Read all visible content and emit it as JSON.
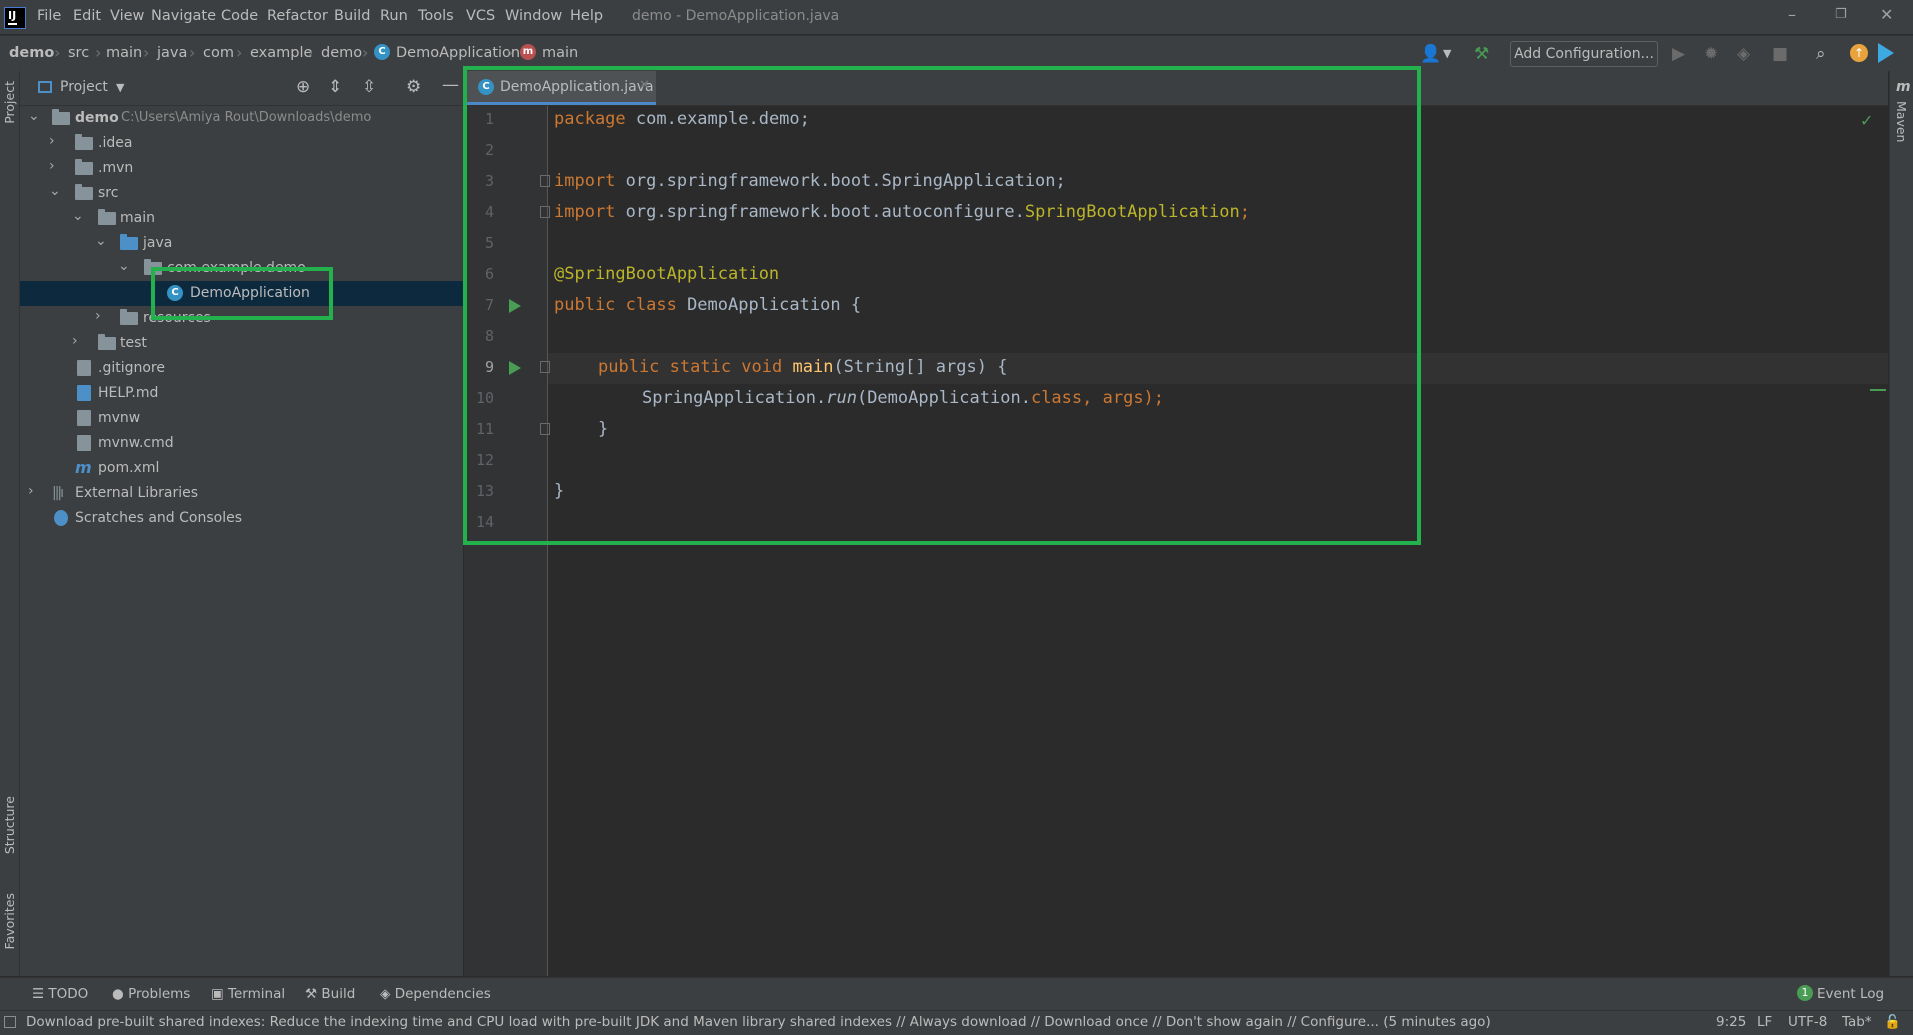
{
  "app": {
    "window_title": "demo - DemoApplication.java",
    "logo_text": "IJ"
  },
  "menu": [
    "File",
    "Edit",
    "View",
    "Navigate",
    "Code",
    "Refactor",
    "Build",
    "Run",
    "Tools",
    "VCS",
    "Window",
    "Help"
  ],
  "window_controls": [
    "–",
    "❐",
    "✕"
  ],
  "breadcrumb": [
    "demo",
    "src",
    "main",
    "java",
    "com",
    "example",
    "demo",
    "DemoApplication",
    "main"
  ],
  "breadcrumb_icons": {
    "class": "C",
    "method": "m"
  },
  "toolbar": {
    "add_configuration": "Add Configuration..."
  },
  "left_strip": {
    "project": "Project",
    "structure": "Structure",
    "favorites": "Favorites"
  },
  "right_strip": {
    "maven": "Maven",
    "maven_icon_text": "m"
  },
  "project_panel": {
    "title": "Project",
    "tree": [
      {
        "label": "demo",
        "path": "C:\\Users\\Amiya Rout\\Downloads\\demo"
      },
      {
        "label": ".idea"
      },
      {
        "label": ".mvn"
      },
      {
        "label": "src"
      },
      {
        "label": "main"
      },
      {
        "label": "java"
      },
      {
        "label": "com.example.demo"
      },
      {
        "label": "DemoApplication"
      },
      {
        "label": "resources"
      },
      {
        "label": "test"
      },
      {
        "label": ".gitignore"
      },
      {
        "label": "HELP.md"
      },
      {
        "label": "mvnw"
      },
      {
        "label": "mvnw.cmd"
      },
      {
        "label": "pom.xml"
      },
      {
        "label": "External Libraries"
      },
      {
        "label": "Scratches and Consoles"
      }
    ]
  },
  "editor": {
    "tab_label": "DemoApplication.java",
    "line_numbers": [
      "1",
      "2",
      "3",
      "4",
      "5",
      "6",
      "7",
      "8",
      "9",
      "10",
      "11",
      "12",
      "13",
      "14"
    ],
    "code": {
      "l1_kw": "package",
      "l1_rest": " com.example.demo;",
      "l3_kw": "import",
      "l3_rest": " org.springframework.boot.SpringApplication;",
      "l4_kw": "import",
      "l4_mid": " org.springframework.boot.autoconfigure.",
      "l4_ann": "SpringBootApplication",
      "l4_end": ";",
      "l6_ann": "@SpringBootApplication",
      "l7_kw": "public class",
      "l7_rest": " DemoApplication {",
      "l9_kw": "public static void",
      "l9_fn": "main",
      "l9_rest": "(String[] args) {",
      "l10_a": "SpringApplication.",
      "l10_run": "run",
      "l10_b": "(DemoApplication.",
      "l10_cls": "class",
      "l10_c": ", args);",
      "l11": "}",
      "l13": "}"
    }
  },
  "tool_windows": [
    "TODO",
    "Problems",
    "Terminal",
    "Build",
    "Dependencies"
  ],
  "event_log": {
    "label": "Event Log",
    "count": "1"
  },
  "status": {
    "message": "Download pre-built shared indexes: Reduce the indexing time and CPU load with pre-built JDK and Maven library shared indexes // Always download // Download once // Don't show again // Configure... (5 minutes ago)",
    "position": "9:25",
    "line_sep": "LF",
    "encoding": "UTF-8",
    "indent": "Tab*"
  },
  "colors": {
    "highlight": "#22b14c",
    "selection": "#0d293e",
    "keyword": "#cc7832",
    "annotation": "#bbb529",
    "function": "#ffc66d"
  }
}
